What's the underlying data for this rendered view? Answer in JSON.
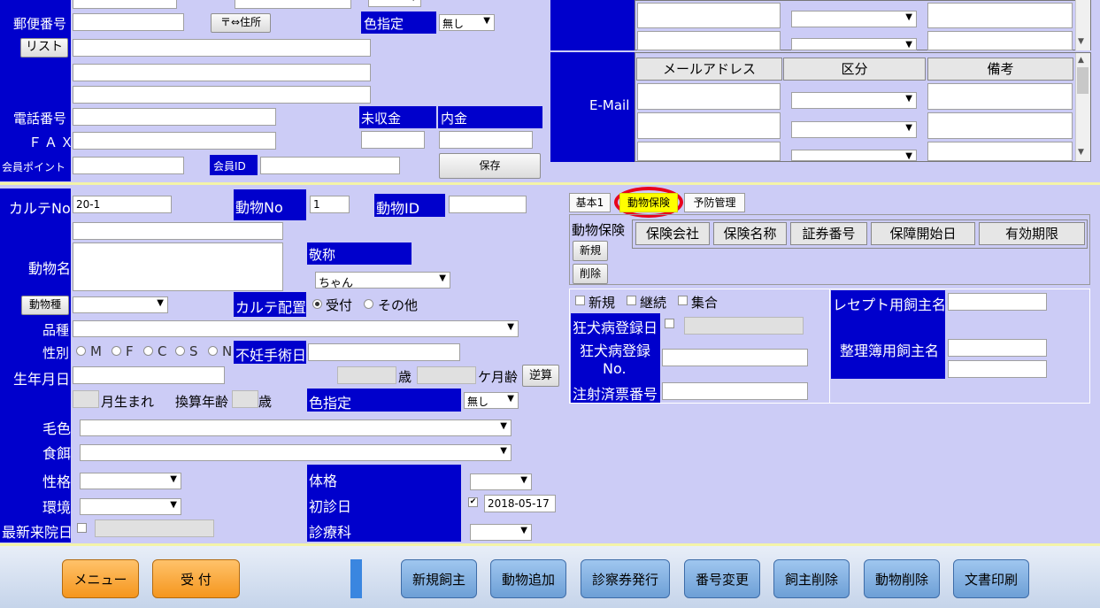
{
  "owner": {
    "postal_label": "郵便番号",
    "postal_btn": "〒⇔住所",
    "list_btn": "リスト",
    "color_label": "色指定",
    "color_value": "無し",
    "phone_label": "電話番号",
    "fax_label": "ＦＡＸ",
    "points_label": "会員ポイント",
    "member_id_label": "会員ID",
    "unpaid_label": "未収金",
    "deposit_label": "内金",
    "save_btn": "保存"
  },
  "email": {
    "section_label": "E-Mail",
    "headers": [
      "メールアドレス",
      "区分",
      "備考"
    ]
  },
  "animal": {
    "karte_no_label": "カルテNo",
    "karte_no_value": "20-1",
    "animal_no_label": "動物No",
    "animal_no_value": "1",
    "animal_id_label": "動物ID",
    "name_label": "動物名",
    "honorific_label": "敬称",
    "honorific_value": "ちゃん",
    "species_btn": "動物種",
    "karte_place_label": "カルテ配置",
    "radio_reception": "受付",
    "radio_other": "その他",
    "breed_label": "品種",
    "sex_label": "性別",
    "sex_options": [
      "M",
      "F",
      "C",
      "S",
      "N"
    ],
    "neuter_label": "不妊手術日",
    "birthday_label": "生年月日",
    "age_unit": "歳",
    "month_unit": "ケ月齢",
    "reverse_btn": "逆算",
    "born_month": "月生まれ",
    "conv_age_label": "換算年齢",
    "conv_age_unit": "歳",
    "color_label": "色指定",
    "color_value": "無し",
    "coat_label": "毛色",
    "food_label": "食餌",
    "temperament_label": "性格",
    "env_label": "環境",
    "last_visit_label": "最新来院日",
    "body_label": "体格",
    "first_visit_label": "初診日",
    "first_visit_value": "2018-05-17",
    "dept_label": "診療科"
  },
  "tabs": [
    "基本1",
    "動物保険",
    "予防管理"
  ],
  "insurance": {
    "label": "動物保険",
    "new_btn": "新規",
    "delete_btn": "削除",
    "headers": [
      "保険会社",
      "保険名称",
      "証券番号",
      "保障開始日",
      "有効期限"
    ]
  },
  "rabies": {
    "chk_new": "新規",
    "chk_continue": "継続",
    "chk_group": "集合",
    "reg_date_label": "狂犬病登録日",
    "reg_no_label_1": "狂犬病登録",
    "reg_no_label_2": "No.",
    "injection_label": "注射済票番号",
    "receipt_owner_label": "レセプト用飼主名",
    "ledger_owner_label": "整理簿用飼主名"
  },
  "footer": {
    "menu": "メニュー",
    "reception": "受 付",
    "new_owner": "新規飼主",
    "add_animal": "動物追加",
    "issue_card": "診察券発行",
    "change_no": "番号変更",
    "delete_owner": "飼主削除",
    "delete_animal": "動物削除",
    "print_doc": "文書印刷"
  },
  "colors": {
    "label_bg": "#0000cc",
    "page_bg": "#ccccf6",
    "highlight": "#ffff00",
    "ring": "#e8001c",
    "orange_btn": "#f5961e",
    "blue_btn": "#6d9fd6"
  }
}
